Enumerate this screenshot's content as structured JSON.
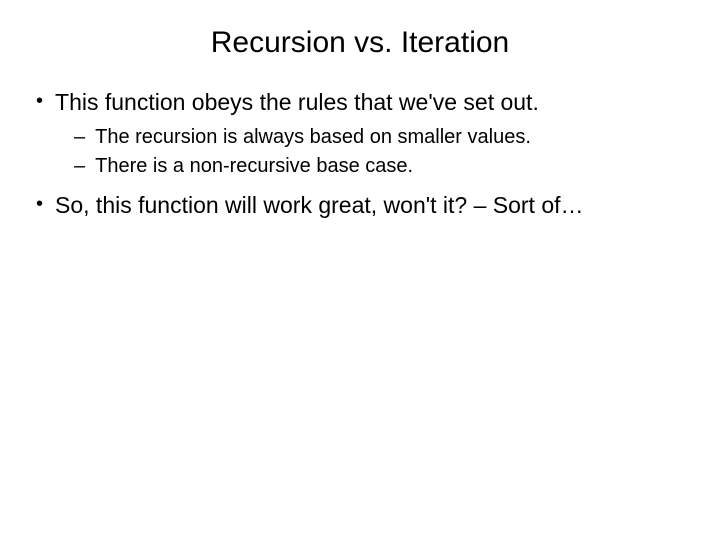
{
  "slide": {
    "title": "Recursion vs. Iteration",
    "bullets": {
      "b1": "This function obeys the rules that we've set out.",
      "b1a": "The recursion is always based on smaller values.",
      "b1b": "There is a non-recursive base case.",
      "b2": "So, this function will work great, won't it? – Sort of…"
    }
  }
}
